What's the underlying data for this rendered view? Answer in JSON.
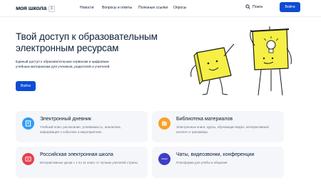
{
  "header": {
    "logo": "моя школа",
    "logo_badge": "β",
    "nav": [
      "Новости",
      "Вопросы и ответы",
      "Полезные ссылки",
      "Опросы"
    ],
    "search_label": "Поиск",
    "login_label": "Войти"
  },
  "hero": {
    "title": "Твой доступ к образовательным электронным ресурсам",
    "description": "Единый доступ к образовательным сервисам и цифровым учебным материалам для учеников, родителей и учителей",
    "login_label": "Войти"
  },
  "cards": [
    {
      "title": "Электронный дневник",
      "description": "Учебный план, расписание, успеваемость, аналитика, информация о событиях и мероприятиях",
      "icon": "diary-icon",
      "color": "#2f9cf5"
    },
    {
      "title": "Библиотека материалов",
      "description": "Электронные книги, курсы, обучающие видео, интерактивный контент и тренажёры",
      "icon": "library-icon",
      "color": "#f7a12a"
    },
    {
      "title": "Российская электронная школа",
      "description": "Интерактивные уроки с 1 по 11 класс от лучших учителей страны",
      "icon": "video-lesson-icon",
      "color": "#e5414e"
    },
    {
      "title": "Чаты, видеозвонки, конференции",
      "description": "Платформа для учёбы и общения",
      "icon": "sferum-logo-icon",
      "icon_text": "сферум",
      "color": "#3d3fc2"
    }
  ],
  "colors": {
    "primary": "#0d4cd3",
    "text": "#0b1f33",
    "card_background": "#f4f6fa",
    "illustration_yellow": "#f5ef45"
  }
}
